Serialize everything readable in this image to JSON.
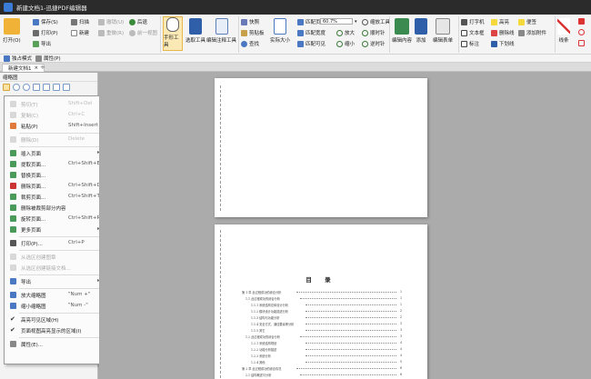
{
  "window": {
    "title": "新建文档1-迅捷PDF编辑器"
  },
  "ribbon": {
    "open": "打开(O)",
    "file_group": [
      "保存(S)",
      "打印(P)",
      "导出"
    ],
    "scan_group": [
      "扫描",
      "新建"
    ],
    "undo_group": [
      "撤销(U)",
      "重做(R)"
    ],
    "history_group": [
      "后退",
      "前一视图"
    ],
    "hand_tool": "手形工具",
    "select_tool": "选取工具",
    "edit_tool": "编辑注释工具",
    "clip_group": [
      "快照",
      "剪贴板",
      "查找"
    ],
    "actual_size": "实际大小",
    "fit_group": [
      "匹配页面",
      "匹配宽度",
      "匹配可见"
    ],
    "zoom_value": "60.7%",
    "zoom_group": [
      "放大",
      "缩小"
    ],
    "zoom_tool": "缩放工具",
    "rotate_group": [
      "顺时针",
      "逆时针"
    ],
    "edit_content": "编辑内容",
    "add": "添加",
    "edit_form": "编辑表单",
    "annot_group_1": [
      "打字机",
      "文本框",
      "标注"
    ],
    "annot_group_2": [
      "高亮",
      "删除线",
      "下划线"
    ],
    "annot_group_3": [
      "便签",
      "添加附件"
    ],
    "line": "线条"
  },
  "toolrow": [
    "独占模式",
    "属性(P)"
  ],
  "tabs": {
    "active": "新建文档1"
  },
  "panel": {
    "title": "缩略图"
  },
  "menu": {
    "items": [
      {
        "label": "剪切(T)",
        "key": "Shift+Del",
        "disabled": true
      },
      {
        "label": "复制(C)",
        "key": "Ctrl+C",
        "disabled": true
      },
      {
        "label": "粘贴(P)",
        "key": "Shift+Insert",
        "disabled": false
      },
      {
        "label": "删除(D)",
        "key": "Delete",
        "disabled": true
      },
      {
        "label": "插入页面",
        "key": "",
        "disabled": false,
        "submenu": true
      },
      {
        "label": "提取页面...",
        "key": "Ctrl+Shift+E",
        "disabled": false
      },
      {
        "label": "替换页面...",
        "key": "",
        "disabled": false
      },
      {
        "label": "删除页面...",
        "key": "Ctrl+Shift+D",
        "disabled": false
      },
      {
        "label": "裁剪页面...",
        "key": "Ctrl+Shift+T",
        "disabled": false
      },
      {
        "label": "删除被裁剪部分内容",
        "key": "",
        "disabled": false
      },
      {
        "label": "旋转页面...",
        "key": "Ctrl+Shift+R",
        "disabled": false
      },
      {
        "label": "更多页面",
        "key": "",
        "disabled": false,
        "submenu": true
      },
      {
        "label": "打印(P)...",
        "key": "Ctrl+P",
        "disabled": false
      },
      {
        "label": "从选区创建图章",
        "key": "",
        "disabled": true
      },
      {
        "label": "从选区创建链接文档...",
        "key": "",
        "disabled": true
      },
      {
        "label": "导出",
        "key": "",
        "disabled": false,
        "submenu": true
      },
      {
        "label": "放大缩略图",
        "key": "\"Num +\"",
        "disabled": false
      },
      {
        "label": "缩小缩略图",
        "key": "\"Num -\"",
        "disabled": false
      },
      {
        "label": "高亮可见区域(H)",
        "key": "",
        "disabled": false,
        "checked": true
      },
      {
        "label": "页面视图高亮显示的区域(I)",
        "key": "",
        "disabled": false,
        "checked": true
      },
      {
        "label": "属性(E)...",
        "key": "",
        "disabled": false
      }
    ]
  },
  "document": {
    "toc_title": "目  录",
    "toc_entries": [
      {
        "text": "第 1 章   此过程成功的综合分析",
        "page": "1"
      },
      {
        "text": "1.1  此过程成功的综合分析",
        "page": "1"
      },
      {
        "text": "1.1.1  系统结构总体设计分析",
        "page": "1"
      },
      {
        "text": "1.1.2  模块设计功能描述分析",
        "page": "2"
      },
      {
        "text": "1.1.3  结构与功能分析",
        "page": "2"
      },
      {
        "text": "1.1.4  安全方式、通信要素等分析",
        "page": "3"
      },
      {
        "text": "1.1.5  其它",
        "page": "3"
      },
      {
        "text": "1.2  此过程成功的综合分析",
        "page": "3"
      },
      {
        "text": "1.2.1  系统结构规划",
        "page": "4"
      },
      {
        "text": "1.2.2  功能分析描述",
        "page": "4"
      },
      {
        "text": "1.2.3  系统分析",
        "page": "4"
      },
      {
        "text": "1.2.4  其他",
        "page": "5"
      },
      {
        "text": "第 2 章   此过程成功的综合情况",
        "page": "6"
      },
      {
        "text": "2.1  结构概述与分析",
        "page": "6"
      }
    ]
  },
  "colors": {
    "ribbon_bg": "#f4f4f4",
    "selected_tool_bg": "#fbe9b5",
    "title_bar": "#2b2b2b",
    "workspace": "#ababab"
  }
}
